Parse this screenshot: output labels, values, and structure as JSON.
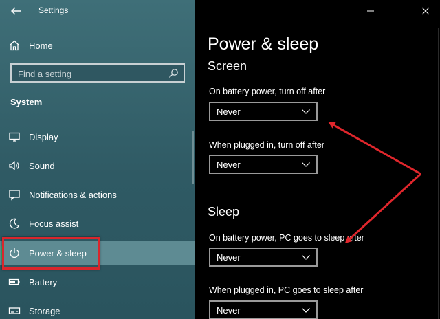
{
  "window": {
    "title": "Settings"
  },
  "sidebar": {
    "home_label": "Home",
    "search_placeholder": "Find a setting",
    "section_label": "System",
    "items": [
      {
        "label": "Display",
        "icon": "display-icon"
      },
      {
        "label": "Sound",
        "icon": "sound-icon"
      },
      {
        "label": "Notifications & actions",
        "icon": "notifications-icon"
      },
      {
        "label": "Focus assist",
        "icon": "focus-assist-icon"
      },
      {
        "label": "Power & sleep",
        "icon": "power-icon",
        "selected": true
      },
      {
        "label": "Battery",
        "icon": "battery-icon"
      },
      {
        "label": "Storage",
        "icon": "storage-icon"
      }
    ]
  },
  "main": {
    "title": "Power & sleep",
    "screen": {
      "heading": "Screen",
      "battery_label": "On battery power, turn off after",
      "battery_value": "Never",
      "plugged_label": "When plugged in, turn off after",
      "plugged_value": "Never"
    },
    "sleep": {
      "heading": "Sleep",
      "battery_label": "On battery power, PC goes to sleep after",
      "battery_value": "Never",
      "plugged_label": "When plugged in, PC goes to sleep after",
      "plugged_value": "Never"
    }
  },
  "colors": {
    "sidebar_bg": "#3f6f78",
    "content_bg": "#000000",
    "selected_accent": "#36c278",
    "annotation_red": "#d9262c"
  }
}
